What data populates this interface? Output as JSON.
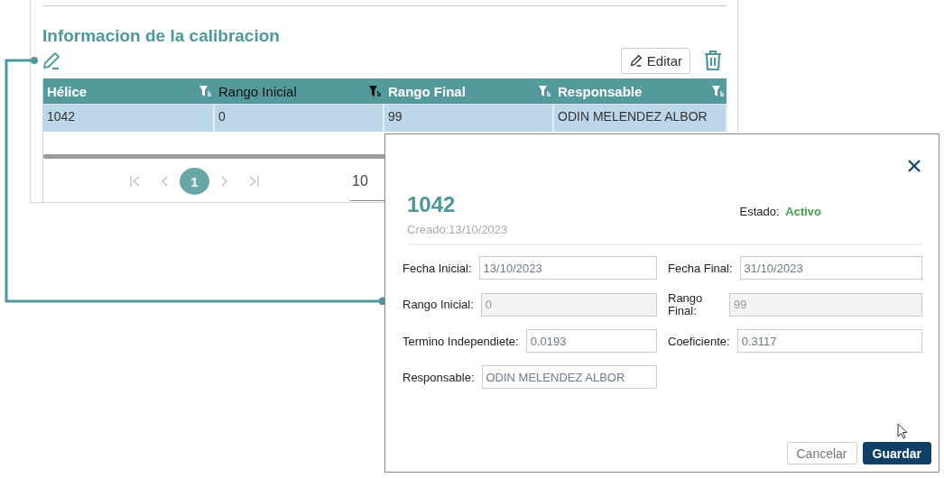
{
  "section": {
    "title": "Informacion de la calibracion",
    "edit_button": "Editar"
  },
  "table": {
    "columns": [
      {
        "label": "Hélice",
        "hovered": false
      },
      {
        "label": "Rango Inicial",
        "hovered": true
      },
      {
        "label": "Rango Final",
        "hovered": false
      },
      {
        "label": "Responsable",
        "hovered": false
      }
    ],
    "rows": [
      {
        "cells": [
          "1042",
          "0",
          "99",
          "ODIN MELENDEZ ALBOR"
        ],
        "selected": true
      }
    ]
  },
  "pagination": {
    "pages": [
      {
        "label": "1",
        "selected": true
      }
    ],
    "page_size": "10"
  },
  "dialog": {
    "title": "1042",
    "created": "Creado:13/10/2023",
    "status_label": "Estado:",
    "status_value": "Activo",
    "fields": [
      {
        "label": "Fecha Inicial:",
        "value": "13/10/2023",
        "disabled": false
      },
      {
        "label": "Fecha Final:",
        "value": "31/10/2023",
        "disabled": false
      },
      {
        "label": "Rango Inicial:",
        "value": "0",
        "disabled": true
      },
      {
        "label": "Rango Final:",
        "value": "99",
        "disabled": true
      },
      {
        "label": "Termino Independiete:",
        "value": "0.0193",
        "disabled": false
      },
      {
        "label": "Coeficiente:",
        "value": "0.3117",
        "disabled": false
      },
      {
        "label": "Responsable:",
        "value": "ODIN MELENDEZ ALBOR",
        "disabled": false
      }
    ],
    "buttons": [
      {
        "label": "Cancelar",
        "kind": "secondary"
      },
      {
        "label": "Guardar",
        "kind": "primary"
      }
    ]
  }
}
